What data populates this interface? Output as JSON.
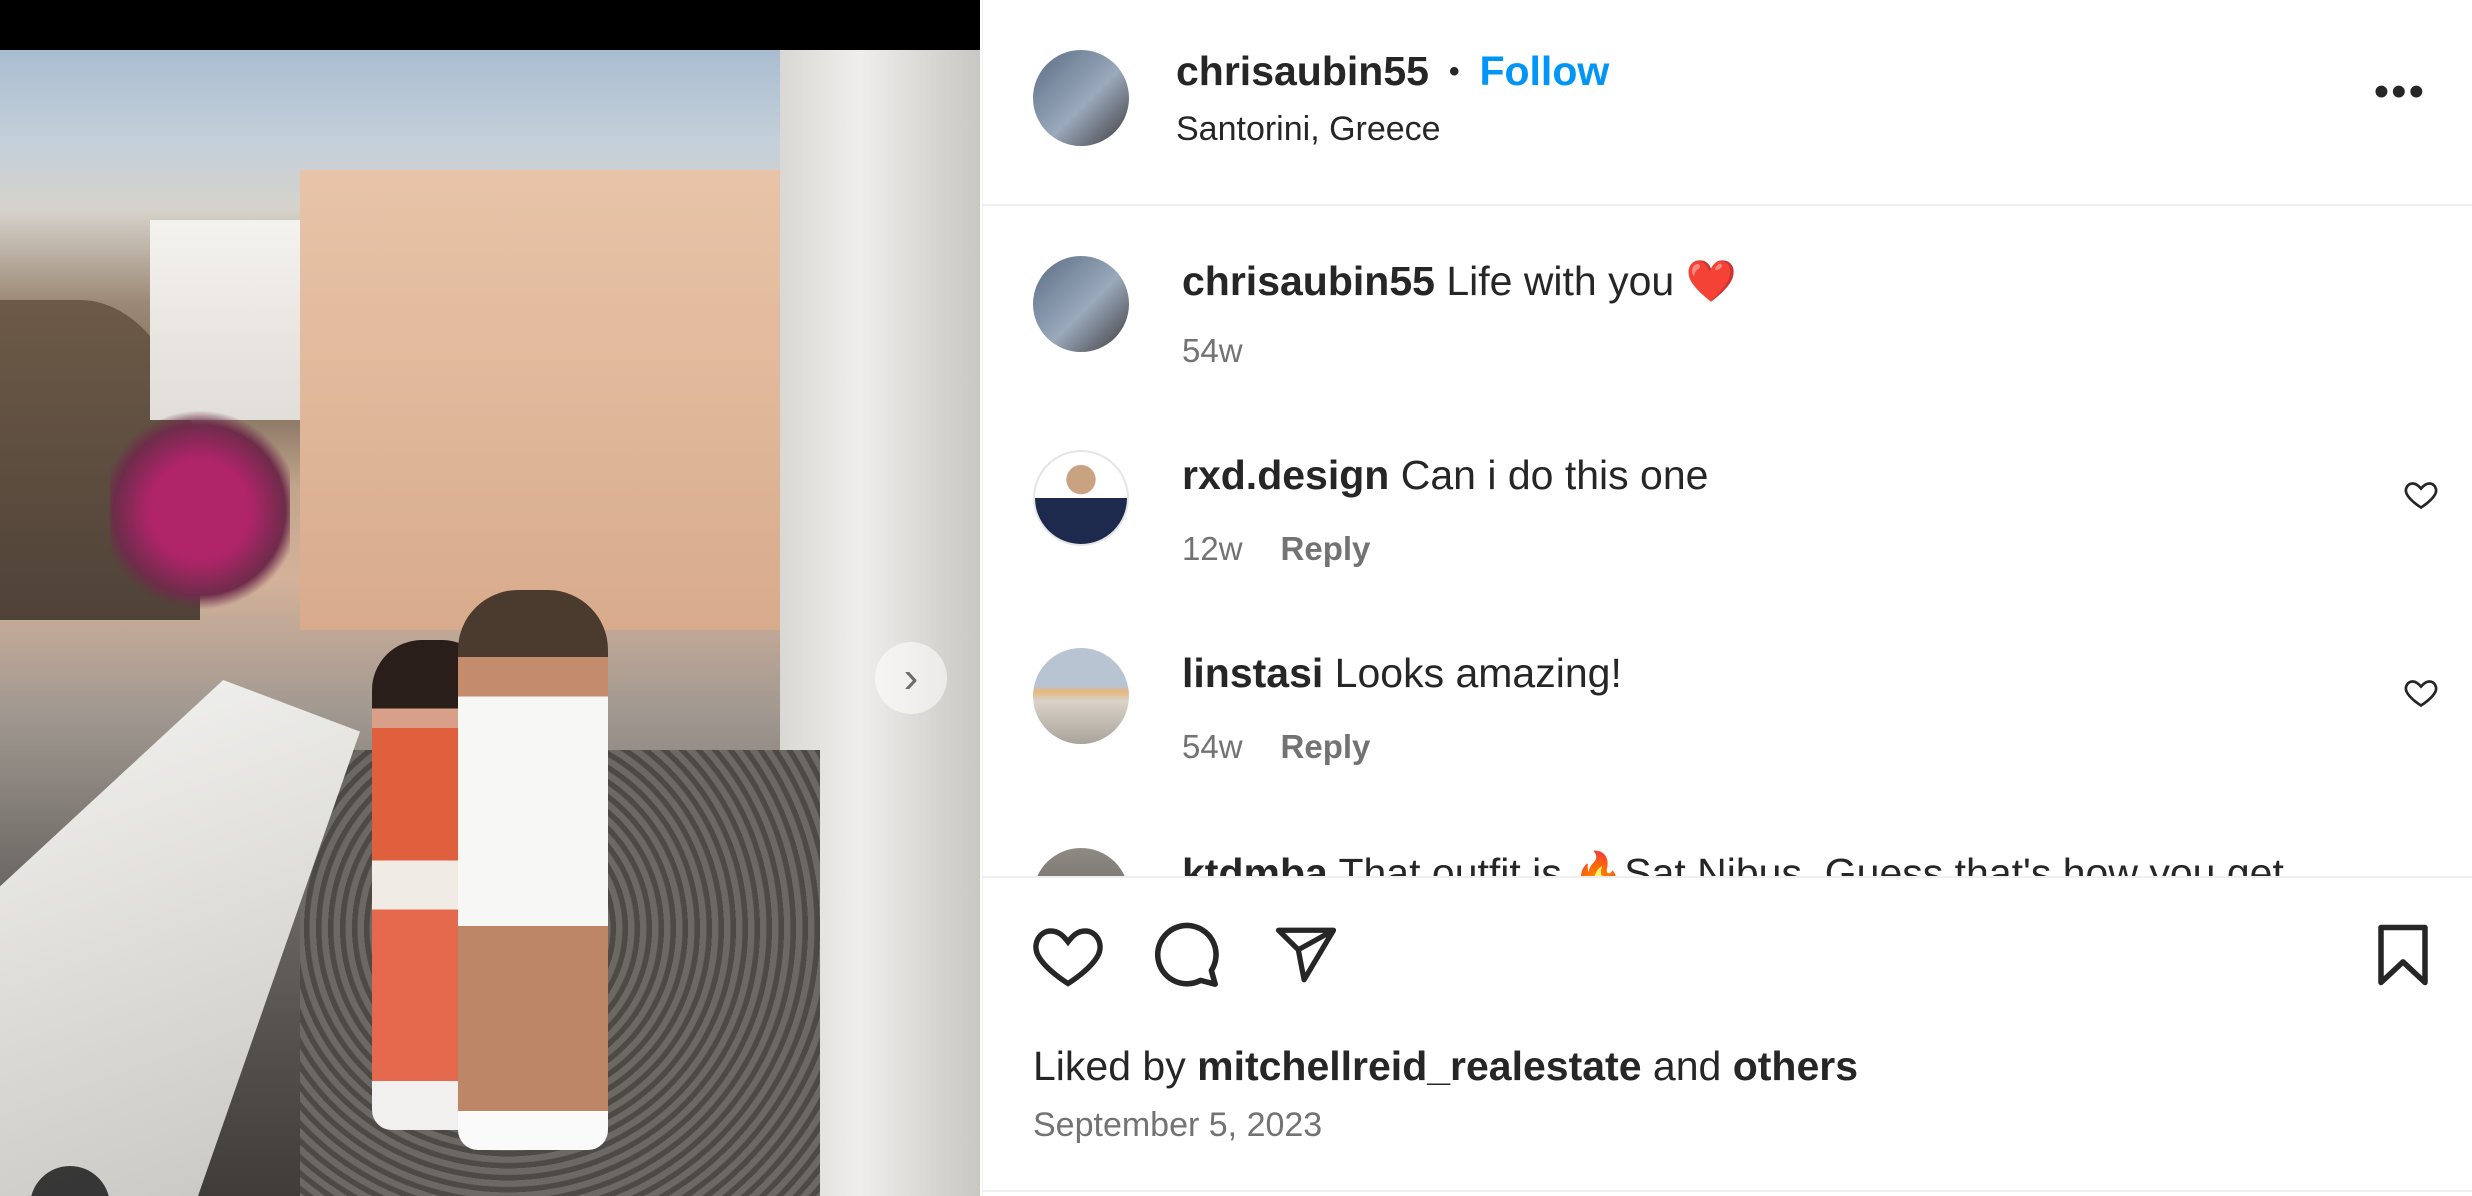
{
  "post": {
    "username": "chrisaubin55",
    "separator": "•",
    "follow_label": "Follow",
    "location": "Santorini, Greece",
    "more_label": "•••",
    "next_label": "›"
  },
  "comments": [
    {
      "username": "chrisaubin55",
      "text": " Life with you ❤️",
      "time": "54w",
      "reply": ""
    },
    {
      "username": "rxd.design",
      "text": " Can i do this one",
      "time": "12w",
      "reply": "Reply"
    },
    {
      "username": "linstasi",
      "text": " Looks amazing!",
      "time": "54w",
      "reply": "Reply"
    },
    {
      "username": "ktdmba",
      "text": " That outfit is 🔥Sat Nibus. Guess that's how you get",
      "time": "",
      "reply": ""
    }
  ],
  "likes": {
    "prefix": "Liked by ",
    "user": "mitchellreid_realestate",
    "middle": " and ",
    "others": "others"
  },
  "date": "September 5, 2023",
  "icons": [
    "heart-icon",
    "comment-icon",
    "share-icon",
    "bookmark-icon",
    "more-icon",
    "chevron-right-icon"
  ],
  "colors": {
    "accent": "#0095f6",
    "text": "#262626",
    "muted": "#737373",
    "border": "#efefef"
  }
}
